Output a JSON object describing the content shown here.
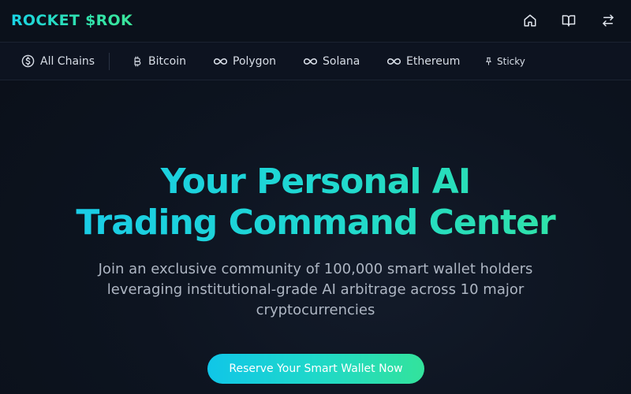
{
  "header": {
    "logo": "ROCKET $ROK",
    "icons": [
      "home-icon",
      "book-open-icon",
      "swap-arrows-icon"
    ]
  },
  "chains": {
    "all": "All Chains",
    "bitcoin": "Bitcoin",
    "polygon": "Polygon",
    "solana": "Solana",
    "ethereum": "Ethereum",
    "sticky": "Sticky"
  },
  "hero": {
    "title_line1": "Your Personal AI",
    "title_line2": "Trading Command Center",
    "subtitle": "Join an exclusive community of 100,000 smart wallet holders leveraging institutional-grade AI arbitrage across 10 major cryptocurrencies",
    "cta_label": "Reserve Your Smart Wallet Now"
  },
  "colors": {
    "background": "#0b111b",
    "accent_start": "#18c9ec",
    "accent_end": "#34e59c",
    "nav_text": "#d7dde6",
    "subtitle_text": "#aeb6c3"
  }
}
